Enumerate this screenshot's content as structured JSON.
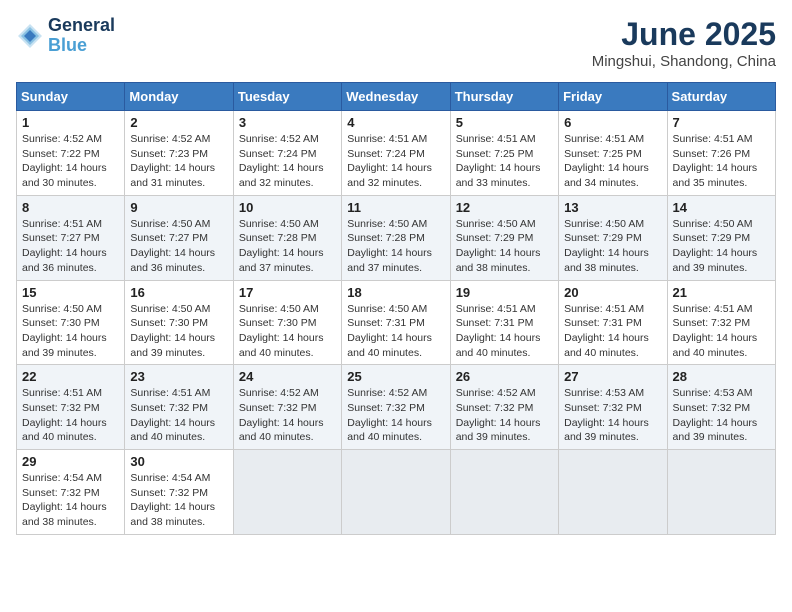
{
  "header": {
    "logo_line1": "General",
    "logo_line2": "Blue",
    "month": "June 2025",
    "location": "Mingshui, Shandong, China"
  },
  "weekdays": [
    "Sunday",
    "Monday",
    "Tuesday",
    "Wednesday",
    "Thursday",
    "Friday",
    "Saturday"
  ],
  "weeks": [
    [
      {
        "day": "1",
        "rise": "4:52 AM",
        "set": "7:22 PM",
        "daylight": "14 hours and 30 minutes."
      },
      {
        "day": "2",
        "rise": "4:52 AM",
        "set": "7:23 PM",
        "daylight": "14 hours and 31 minutes."
      },
      {
        "day": "3",
        "rise": "4:52 AM",
        "set": "7:24 PM",
        "daylight": "14 hours and 32 minutes."
      },
      {
        "day": "4",
        "rise": "4:51 AM",
        "set": "7:24 PM",
        "daylight": "14 hours and 32 minutes."
      },
      {
        "day": "5",
        "rise": "4:51 AM",
        "set": "7:25 PM",
        "daylight": "14 hours and 33 minutes."
      },
      {
        "day": "6",
        "rise": "4:51 AM",
        "set": "7:25 PM",
        "daylight": "14 hours and 34 minutes."
      },
      {
        "day": "7",
        "rise": "4:51 AM",
        "set": "7:26 PM",
        "daylight": "14 hours and 35 minutes."
      }
    ],
    [
      {
        "day": "8",
        "rise": "4:51 AM",
        "set": "7:27 PM",
        "daylight": "14 hours and 36 minutes."
      },
      {
        "day": "9",
        "rise": "4:50 AM",
        "set": "7:27 PM",
        "daylight": "14 hours and 36 minutes."
      },
      {
        "day": "10",
        "rise": "4:50 AM",
        "set": "7:28 PM",
        "daylight": "14 hours and 37 minutes."
      },
      {
        "day": "11",
        "rise": "4:50 AM",
        "set": "7:28 PM",
        "daylight": "14 hours and 37 minutes."
      },
      {
        "day": "12",
        "rise": "4:50 AM",
        "set": "7:29 PM",
        "daylight": "14 hours and 38 minutes."
      },
      {
        "day": "13",
        "rise": "4:50 AM",
        "set": "7:29 PM",
        "daylight": "14 hours and 38 minutes."
      },
      {
        "day": "14",
        "rise": "4:50 AM",
        "set": "7:29 PM",
        "daylight": "14 hours and 39 minutes."
      }
    ],
    [
      {
        "day": "15",
        "rise": "4:50 AM",
        "set": "7:30 PM",
        "daylight": "14 hours and 39 minutes."
      },
      {
        "day": "16",
        "rise": "4:50 AM",
        "set": "7:30 PM",
        "daylight": "14 hours and 39 minutes."
      },
      {
        "day": "17",
        "rise": "4:50 AM",
        "set": "7:30 PM",
        "daylight": "14 hours and 40 minutes."
      },
      {
        "day": "18",
        "rise": "4:50 AM",
        "set": "7:31 PM",
        "daylight": "14 hours and 40 minutes."
      },
      {
        "day": "19",
        "rise": "4:51 AM",
        "set": "7:31 PM",
        "daylight": "14 hours and 40 minutes."
      },
      {
        "day": "20",
        "rise": "4:51 AM",
        "set": "7:31 PM",
        "daylight": "14 hours and 40 minutes."
      },
      {
        "day": "21",
        "rise": "4:51 AM",
        "set": "7:32 PM",
        "daylight": "14 hours and 40 minutes."
      }
    ],
    [
      {
        "day": "22",
        "rise": "4:51 AM",
        "set": "7:32 PM",
        "daylight": "14 hours and 40 minutes."
      },
      {
        "day": "23",
        "rise": "4:51 AM",
        "set": "7:32 PM",
        "daylight": "14 hours and 40 minutes."
      },
      {
        "day": "24",
        "rise": "4:52 AM",
        "set": "7:32 PM",
        "daylight": "14 hours and 40 minutes."
      },
      {
        "day": "25",
        "rise": "4:52 AM",
        "set": "7:32 PM",
        "daylight": "14 hours and 40 minutes."
      },
      {
        "day": "26",
        "rise": "4:52 AM",
        "set": "7:32 PM",
        "daylight": "14 hours and 39 minutes."
      },
      {
        "day": "27",
        "rise": "4:53 AM",
        "set": "7:32 PM",
        "daylight": "14 hours and 39 minutes."
      },
      {
        "day": "28",
        "rise": "4:53 AM",
        "set": "7:32 PM",
        "daylight": "14 hours and 39 minutes."
      }
    ],
    [
      {
        "day": "29",
        "rise": "4:54 AM",
        "set": "7:32 PM",
        "daylight": "14 hours and 38 minutes."
      },
      {
        "day": "30",
        "rise": "4:54 AM",
        "set": "7:32 PM",
        "daylight": "14 hours and 38 minutes."
      },
      null,
      null,
      null,
      null,
      null
    ]
  ]
}
